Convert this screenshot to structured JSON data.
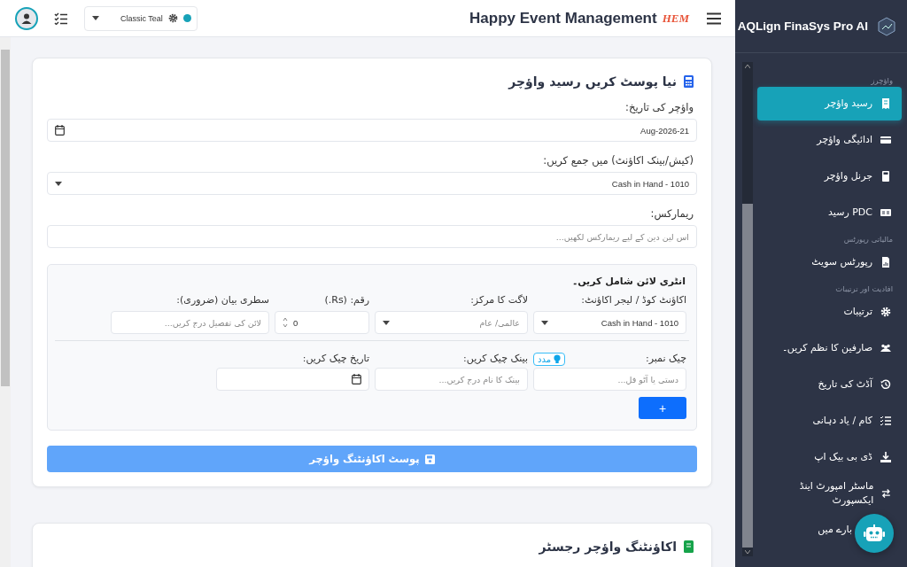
{
  "topbar": {
    "title": "Happy Event Management",
    "logo_text": "HEM",
    "theme": {
      "label": "Classic Teal",
      "color": "#17a2b8"
    }
  },
  "sidebar": {
    "brand": "AQLign FinaSys Pro AI",
    "sections": [
      {
        "heading": "واؤچرز",
        "items": [
          {
            "label": "رسید واؤچر",
            "selected": true
          },
          {
            "label": "ادائیگی واؤچر",
            "selected": false
          },
          {
            "label": "جرنل واؤچر",
            "selected": false
          },
          {
            "label": "PDC رسید",
            "selected": false
          }
        ]
      },
      {
        "heading": "مالیاتی رپورٹس",
        "items": [
          {
            "label": "رپورٹس سویٹ",
            "selected": false
          }
        ]
      },
      {
        "heading": "افادیت اور ترتیبات",
        "items": [
          {
            "label": "ترتیبات",
            "selected": false
          },
          {
            "label": "صارفین کا نظم کریں۔",
            "selected": false
          },
          {
            "label": "آڈٹ کی تاریخ",
            "selected": false
          },
          {
            "label": "کام / یاد دہانی",
            "selected": false
          },
          {
            "label": "ڈی بی بیک اپ",
            "selected": false
          },
          {
            "label": "ماسٹر امپورٹ اینڈ ایکسپورٹ",
            "selected": false
          },
          {
            "label": "بارے میں",
            "selected": false
          }
        ]
      }
    ]
  },
  "voucher_form": {
    "title": "نیا پوسٹ کریں رسید واؤچر",
    "date": {
      "label": "واؤچر کی تاریخ:",
      "value": "Aug-2026-21"
    },
    "account": {
      "label": "(کیش/بینک اکاؤنٹ) میں جمع کریں:",
      "value": "Cash in Hand - 1010"
    },
    "remarks": {
      "label": "ریمارکس:",
      "placeholder": "اس لین دین کے لیے ریمارکس لکھیں..."
    },
    "line_entry": {
      "title": "انٹری لائن شامل کریں۔",
      "account": {
        "label": "اکاؤنٹ کوڈ / لیجر اکاؤنٹ:",
        "value": "Cash in Hand - 1010"
      },
      "cost_center": {
        "label": "لاگت کا مرکز:",
        "placeholder": "عالمی/ عام"
      },
      "amount": {
        "label": "رقم: (Rs.)",
        "value": "0"
      },
      "description": {
        "label": "سطری بیان (ضروری):",
        "placeholder": "لائن کی تفصیل درج کریں..."
      },
      "cheque_no": {
        "label": "چیک نمبر:",
        "placeholder": "دستی یا آٹو فل...",
        "help": "مدد"
      },
      "bank": {
        "label": "بینک چیک کریں:",
        "placeholder": "بینک کا نام درج کریں..."
      },
      "cheque_date": {
        "label": "تاریخ چیک کریں:"
      },
      "add_button": "+"
    },
    "post_button": "پوسٹ اکاؤنٹنگ واؤچر"
  },
  "register": {
    "title": "اکاؤنٹنگ واؤچر رجسٹر"
  }
}
